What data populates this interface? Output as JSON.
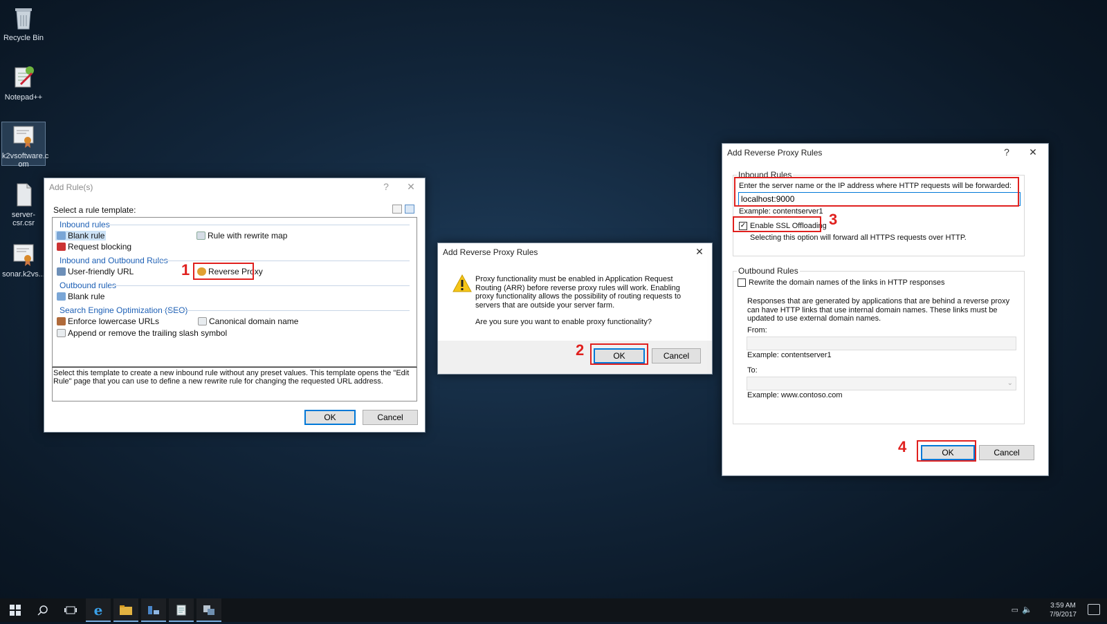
{
  "desktop": {
    "icons": [
      {
        "label": "Recycle Bin",
        "icon": "recycle-bin-icon"
      },
      {
        "label": "Notepad++",
        "icon": "notepad-plus-plus-icon"
      },
      {
        "label": "k2vsoftware.c om",
        "icon": "certificate-file-icon"
      },
      {
        "label": "server-csr.csr",
        "icon": "document-file-icon"
      },
      {
        "label": "sonar.k2vs...",
        "icon": "certificate-file-icon"
      }
    ]
  },
  "add_rules": {
    "title": "Add Rule(s)",
    "help": "?",
    "close": "✕",
    "select_label": "Select a rule template:",
    "groups": [
      {
        "header": "Inbound rules",
        "items": [
          "Blank rule",
          "Rule with rewrite map",
          "Request blocking"
        ]
      },
      {
        "header": "Inbound and Outbound Rules",
        "items": [
          "User-friendly URL",
          "Reverse Proxy"
        ]
      },
      {
        "header": "Outbound rules",
        "items": [
          "Blank rule"
        ]
      },
      {
        "header": "Search Engine Optimization (SEO)",
        "items": [
          "Enforce lowercase URLs",
          "Canonical domain name",
          "Append or remove the trailing slash symbol"
        ]
      }
    ],
    "description": "Select this template to create a new inbound rule without any preset values. This template opens the \"Edit Rule\" page that you can use to define a new rewrite rule for changing the requested URL address.",
    "ok": "OK",
    "cancel": "Cancel",
    "step": "1"
  },
  "confirm": {
    "title": "Add Reverse Proxy Rules",
    "close": "✕",
    "message": "Proxy functionality must be enabled in Application Request Routing (ARR) before reverse proxy rules will work. Enabling proxy functionality allows the possibility of routing requests to servers that are outside your server farm.",
    "question": "Are you sure you want to enable proxy functionality?",
    "ok": "OK",
    "cancel": "Cancel",
    "step": "2"
  },
  "proxy_rules": {
    "title": "Add Reverse Proxy Rules",
    "help": "?",
    "close": "✕",
    "inbound": {
      "group": "Inbound Rules",
      "prompt": "Enter the server name or the IP address where HTTP requests will be forwarded:",
      "value": "localhost:9000",
      "example": "Example: contentserver1",
      "ssl_label": "Enable SSL Offloading",
      "ssl_checked": true,
      "ssl_note": "Selecting this option will forward all HTTPS requests over HTTP.",
      "step": "3"
    },
    "outbound": {
      "group": "Outbound Rules",
      "rewrite_label": "Rewrite the domain names of the links in HTTP responses",
      "rewrite_checked": false,
      "note": "Responses that are generated by applications that are behind a reverse proxy can have HTTP links that use internal domain names. These links must be updated to use external domain names.",
      "from_label": "From:",
      "from_value": "",
      "from_example": "Example: contentserver1",
      "to_label": "To:",
      "to_value": "",
      "to_example": "Example: www.contoso.com"
    },
    "ok": "OK",
    "cancel": "Cancel",
    "step": "4"
  },
  "taskbar": {
    "items": [
      "windows-start-icon",
      "search-icon",
      "task-view-icon",
      "internet-explorer-icon",
      "file-explorer-icon",
      "server-manager-icon",
      "notepad-icon",
      "iis-manager-icon"
    ],
    "time": "3:59 AM",
    "date": "7/9/2017"
  },
  "colors": {
    "accent": "#0078d7",
    "annotation": "#e0201e",
    "group_header": "#1c5fb5"
  }
}
